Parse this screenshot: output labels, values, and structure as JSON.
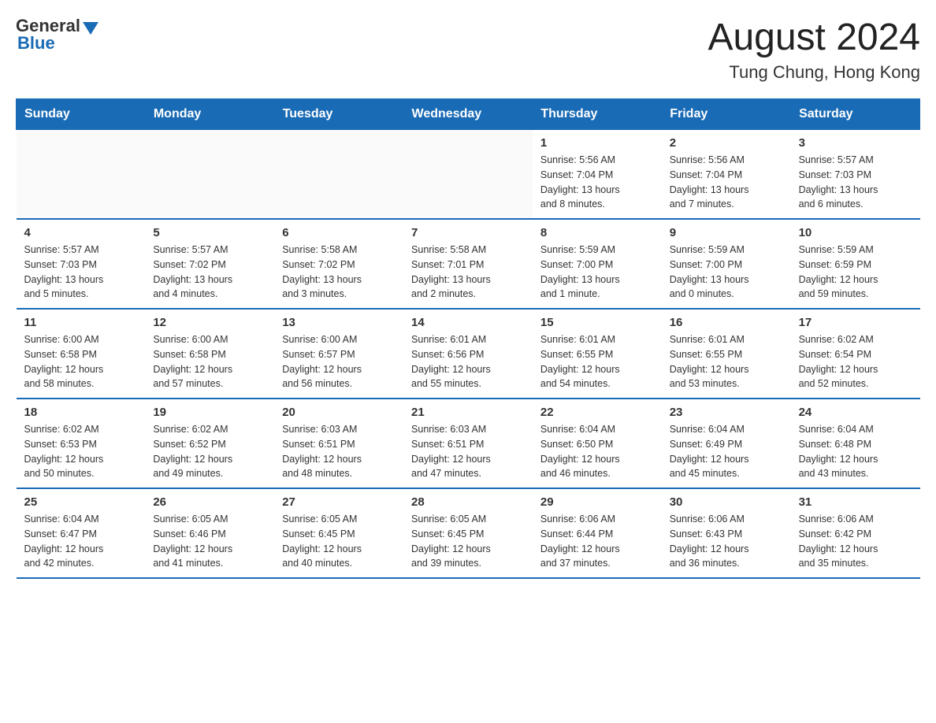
{
  "header": {
    "logo_general": "General",
    "logo_blue": "Blue",
    "main_title": "August 2024",
    "subtitle": "Tung Chung, Hong Kong"
  },
  "days_of_week": [
    "Sunday",
    "Monday",
    "Tuesday",
    "Wednesday",
    "Thursday",
    "Friday",
    "Saturday"
  ],
  "weeks": [
    [
      {
        "day": "",
        "info": ""
      },
      {
        "day": "",
        "info": ""
      },
      {
        "day": "",
        "info": ""
      },
      {
        "day": "",
        "info": ""
      },
      {
        "day": "1",
        "info": "Sunrise: 5:56 AM\nSunset: 7:04 PM\nDaylight: 13 hours\nand 8 minutes."
      },
      {
        "day": "2",
        "info": "Sunrise: 5:56 AM\nSunset: 7:04 PM\nDaylight: 13 hours\nand 7 minutes."
      },
      {
        "day": "3",
        "info": "Sunrise: 5:57 AM\nSunset: 7:03 PM\nDaylight: 13 hours\nand 6 minutes."
      }
    ],
    [
      {
        "day": "4",
        "info": "Sunrise: 5:57 AM\nSunset: 7:03 PM\nDaylight: 13 hours\nand 5 minutes."
      },
      {
        "day": "5",
        "info": "Sunrise: 5:57 AM\nSunset: 7:02 PM\nDaylight: 13 hours\nand 4 minutes."
      },
      {
        "day": "6",
        "info": "Sunrise: 5:58 AM\nSunset: 7:02 PM\nDaylight: 13 hours\nand 3 minutes."
      },
      {
        "day": "7",
        "info": "Sunrise: 5:58 AM\nSunset: 7:01 PM\nDaylight: 13 hours\nand 2 minutes."
      },
      {
        "day": "8",
        "info": "Sunrise: 5:59 AM\nSunset: 7:00 PM\nDaylight: 13 hours\nand 1 minute."
      },
      {
        "day": "9",
        "info": "Sunrise: 5:59 AM\nSunset: 7:00 PM\nDaylight: 13 hours\nand 0 minutes."
      },
      {
        "day": "10",
        "info": "Sunrise: 5:59 AM\nSunset: 6:59 PM\nDaylight: 12 hours\nand 59 minutes."
      }
    ],
    [
      {
        "day": "11",
        "info": "Sunrise: 6:00 AM\nSunset: 6:58 PM\nDaylight: 12 hours\nand 58 minutes."
      },
      {
        "day": "12",
        "info": "Sunrise: 6:00 AM\nSunset: 6:58 PM\nDaylight: 12 hours\nand 57 minutes."
      },
      {
        "day": "13",
        "info": "Sunrise: 6:00 AM\nSunset: 6:57 PM\nDaylight: 12 hours\nand 56 minutes."
      },
      {
        "day": "14",
        "info": "Sunrise: 6:01 AM\nSunset: 6:56 PM\nDaylight: 12 hours\nand 55 minutes."
      },
      {
        "day": "15",
        "info": "Sunrise: 6:01 AM\nSunset: 6:55 PM\nDaylight: 12 hours\nand 54 minutes."
      },
      {
        "day": "16",
        "info": "Sunrise: 6:01 AM\nSunset: 6:55 PM\nDaylight: 12 hours\nand 53 minutes."
      },
      {
        "day": "17",
        "info": "Sunrise: 6:02 AM\nSunset: 6:54 PM\nDaylight: 12 hours\nand 52 minutes."
      }
    ],
    [
      {
        "day": "18",
        "info": "Sunrise: 6:02 AM\nSunset: 6:53 PM\nDaylight: 12 hours\nand 50 minutes."
      },
      {
        "day": "19",
        "info": "Sunrise: 6:02 AM\nSunset: 6:52 PM\nDaylight: 12 hours\nand 49 minutes."
      },
      {
        "day": "20",
        "info": "Sunrise: 6:03 AM\nSunset: 6:51 PM\nDaylight: 12 hours\nand 48 minutes."
      },
      {
        "day": "21",
        "info": "Sunrise: 6:03 AM\nSunset: 6:51 PM\nDaylight: 12 hours\nand 47 minutes."
      },
      {
        "day": "22",
        "info": "Sunrise: 6:04 AM\nSunset: 6:50 PM\nDaylight: 12 hours\nand 46 minutes."
      },
      {
        "day": "23",
        "info": "Sunrise: 6:04 AM\nSunset: 6:49 PM\nDaylight: 12 hours\nand 45 minutes."
      },
      {
        "day": "24",
        "info": "Sunrise: 6:04 AM\nSunset: 6:48 PM\nDaylight: 12 hours\nand 43 minutes."
      }
    ],
    [
      {
        "day": "25",
        "info": "Sunrise: 6:04 AM\nSunset: 6:47 PM\nDaylight: 12 hours\nand 42 minutes."
      },
      {
        "day": "26",
        "info": "Sunrise: 6:05 AM\nSunset: 6:46 PM\nDaylight: 12 hours\nand 41 minutes."
      },
      {
        "day": "27",
        "info": "Sunrise: 6:05 AM\nSunset: 6:45 PM\nDaylight: 12 hours\nand 40 minutes."
      },
      {
        "day": "28",
        "info": "Sunrise: 6:05 AM\nSunset: 6:45 PM\nDaylight: 12 hours\nand 39 minutes."
      },
      {
        "day": "29",
        "info": "Sunrise: 6:06 AM\nSunset: 6:44 PM\nDaylight: 12 hours\nand 37 minutes."
      },
      {
        "day": "30",
        "info": "Sunrise: 6:06 AM\nSunset: 6:43 PM\nDaylight: 12 hours\nand 36 minutes."
      },
      {
        "day": "31",
        "info": "Sunrise: 6:06 AM\nSunset: 6:42 PM\nDaylight: 12 hours\nand 35 minutes."
      }
    ]
  ]
}
